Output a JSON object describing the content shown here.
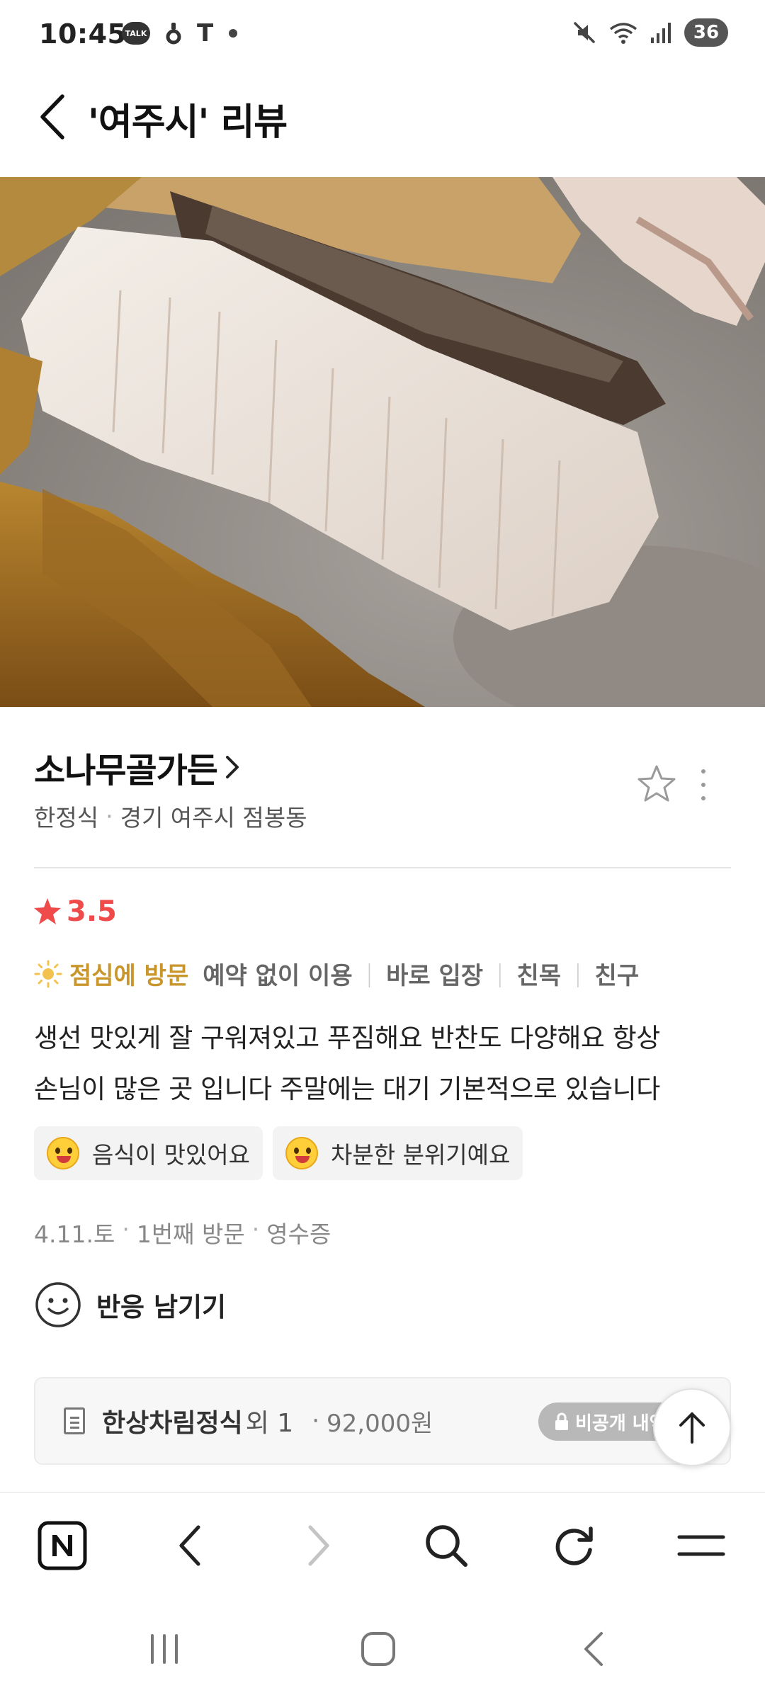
{
  "status_bar": {
    "time": "10:45",
    "talk_badge": "TALK",
    "t_glyph": "T",
    "battery": "36",
    "icons": [
      "kakaotalk-icon",
      "notification-icon",
      "t-icon",
      "mute-icon",
      "wifi-icon",
      "signal-icon"
    ]
  },
  "header": {
    "title": "'여주시' 리뷰"
  },
  "place": {
    "name": "소나무골가든",
    "category": "한정식",
    "meta_sep": "·",
    "location": "경기 여주시 점봉동"
  },
  "review": {
    "rating": "3.5",
    "visit_time": "점심에 방문",
    "visit_tags": [
      "예약 없이 이용",
      "바로 입장",
      "친목",
      "친구"
    ],
    "tag_sep": "|",
    "text_line1": "생선 맛있게 잘 구워져있고 푸짐해요 반찬도 다양해요 항상",
    "text_line2": "손님이 많은 곳 입니다 주말에는 대기 기본적으로 있습니다",
    "keywords": [
      "음식이 맛있어요",
      "차분한 분위기예요"
    ],
    "visit_date": "4.11.토",
    "visit_count": "1번째 방문",
    "verification": "영수증",
    "dot": "·",
    "reaction_label": "반응 남기기"
  },
  "order": {
    "item": "한상차림정식",
    "more": "외 1",
    "sep": "·",
    "price": "92,000원",
    "private_badge": "비공개 내역"
  },
  "colors": {
    "rating_red": "#ef4b4b",
    "visit_gold": "#c9962c"
  }
}
